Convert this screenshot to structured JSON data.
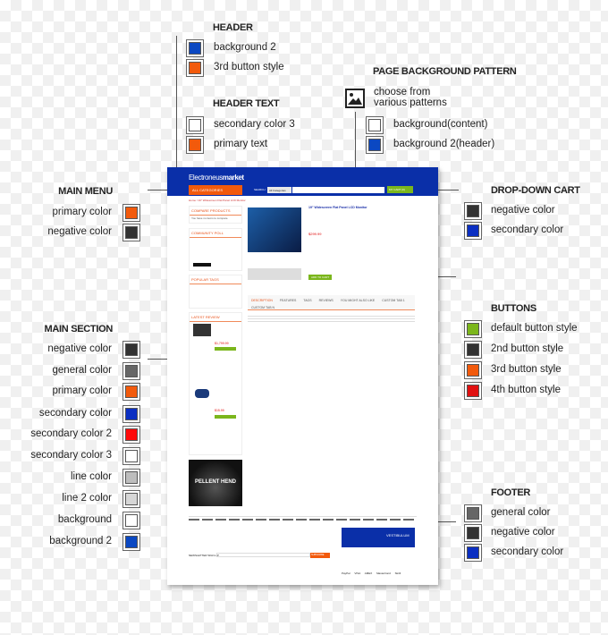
{
  "header": {
    "title": "HEADER",
    "items": [
      {
        "label": "background 2",
        "color": "#0b48c2"
      },
      {
        "label": "3rd button style",
        "color": "#f25a0c"
      }
    ]
  },
  "header_text": {
    "title": "HEADER TEXT",
    "items": [
      {
        "label": "secondary color 3",
        "color": "#ffffff"
      },
      {
        "label": "primary text",
        "color": "#f25a0c"
      }
    ]
  },
  "page_background": {
    "title": "PAGE BACKGROUND PATTERN",
    "icon": "image-icon",
    "note_line1": "choose from",
    "note_line2": "various patterns",
    "items": [
      {
        "label": "background(content)",
        "color": "#ffffff"
      },
      {
        "label": "background 2(header)",
        "color": "#0b48c2"
      }
    ]
  },
  "main_menu": {
    "title": "MAIN MENU",
    "items": [
      {
        "label": "primary color",
        "color": "#f25a0c"
      },
      {
        "label": "negative color",
        "color": "#333333"
      }
    ]
  },
  "main_section": {
    "title": "MAIN SECTION",
    "items": [
      {
        "label": "negative color",
        "color": "#333333"
      },
      {
        "label": "general color",
        "color": "#666666"
      },
      {
        "label": "primary color",
        "color": "#f25a0c"
      },
      {
        "label": "secondary color",
        "color": "#0b2fc2"
      },
      {
        "label": "secondary color 2",
        "color": "#ff0a0a"
      },
      {
        "label": "secondary color 3",
        "color": "#ffffff"
      },
      {
        "label": "line color",
        "color": "#bdbdbd"
      },
      {
        "label": "line 2 color",
        "color": "#d6d6d6"
      },
      {
        "label": "background",
        "color": "#ffffff"
      },
      {
        "label": "background 2",
        "color": "#0b48c2"
      }
    ]
  },
  "dropdown_cart": {
    "title": "DROP-DOWN CART",
    "items": [
      {
        "label": "negative color",
        "color": "#333333"
      },
      {
        "label": "secondary color",
        "color": "#0b2fc2"
      }
    ]
  },
  "buttons": {
    "title": "BUTTONS",
    "items": [
      {
        "label": "default button style",
        "color": "#7bb61c"
      },
      {
        "label": "2nd button style",
        "color": "#333333"
      },
      {
        "label": "3rd button style",
        "color": "#f25a0c"
      },
      {
        "label": "4th button style",
        "color": "#e01010"
      }
    ]
  },
  "footer": {
    "title": "FOOTER",
    "items": [
      {
        "label": "general color",
        "color": "#666666"
      },
      {
        "label": "negative color",
        "color": "#333333"
      },
      {
        "label": "secondary color",
        "color": "#0b2fc2"
      }
    ]
  },
  "mockup": {
    "logo_light": "Electroneus",
    "logo_bold": "market",
    "all_categories": "ALL CATEGORIES",
    "search_label": "SEARCH",
    "category_select": "All Categories",
    "cart_button": "MY CART (0)",
    "breadcrumb": "Home  /  19\" Widescreen Flat Panel LCD Monitor",
    "product_title": "19\" Widescreen Flat Panel LCD Monitor",
    "price": "$299.99",
    "add_to_cart": "ADD TO CART",
    "compare_products": "COMPARE PRODUCTS",
    "compare_text": "You have no items to compare.",
    "community_poll": "COMMUNITY POLL",
    "popular_tags": "POPULAR TAGS",
    "latest_review": "LATEST REVIEW",
    "review1_price": "$1,799.99",
    "review2_price": "$15.99",
    "banner_text": "PELLENT HEND",
    "tabs": [
      "DESCRIPTION",
      "FEATURES",
      "TAGS",
      "REVIEWS",
      "YOU MIGHT ALSO LIKE",
      "CUSTOM TAB 1",
      "CUSTOM TAB N"
    ],
    "newsletter": "NEWSLETTER SIGN-UP",
    "subscribe": "SUBSCRIBE",
    "footer_banner": "VESTIBULUM",
    "payments": [
      "PayPal",
      "VISA",
      "AMEX",
      "MasterCard",
      "Skrill"
    ]
  }
}
